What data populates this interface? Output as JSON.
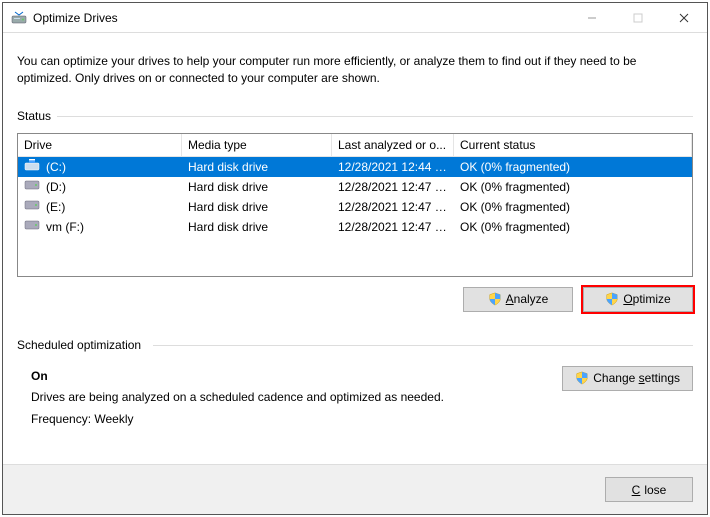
{
  "window": {
    "title": "Optimize Drives"
  },
  "intro": "You can optimize your drives to help your computer run more efficiently, or analyze them to find out if they need to be optimized. Only drives on or connected to your computer are shown.",
  "status_label": "Status",
  "columns": {
    "drive": "Drive",
    "media": "Media type",
    "last": "Last analyzed or o...",
    "status": "Current status"
  },
  "drives": [
    {
      "name": "(C:)",
      "media": "Hard disk drive",
      "last": "12/28/2021 12:44 P...",
      "status": "OK (0% fragmented)",
      "icon": "os",
      "selected": true
    },
    {
      "name": "(D:)",
      "media": "Hard disk drive",
      "last": "12/28/2021 12:47 P...",
      "status": "OK (0% fragmented)",
      "icon": "hdd",
      "selected": false
    },
    {
      "name": "(E:)",
      "media": "Hard disk drive",
      "last": "12/28/2021 12:47 P...",
      "status": "OK (0% fragmented)",
      "icon": "hdd",
      "selected": false
    },
    {
      "name": "vm (F:)",
      "media": "Hard disk drive",
      "last": "12/28/2021 12:47 P...",
      "status": "OK (0% fragmented)",
      "icon": "hdd",
      "selected": false
    }
  ],
  "buttons": {
    "analyze": "Analyze",
    "optimize": "Optimize",
    "change": "Change settings",
    "close": "Close"
  },
  "sched": {
    "label": "Scheduled optimization",
    "state": "On",
    "desc": "Drives are being analyzed on a scheduled cadence and optimized as needed.",
    "freq": "Frequency: Weekly"
  }
}
